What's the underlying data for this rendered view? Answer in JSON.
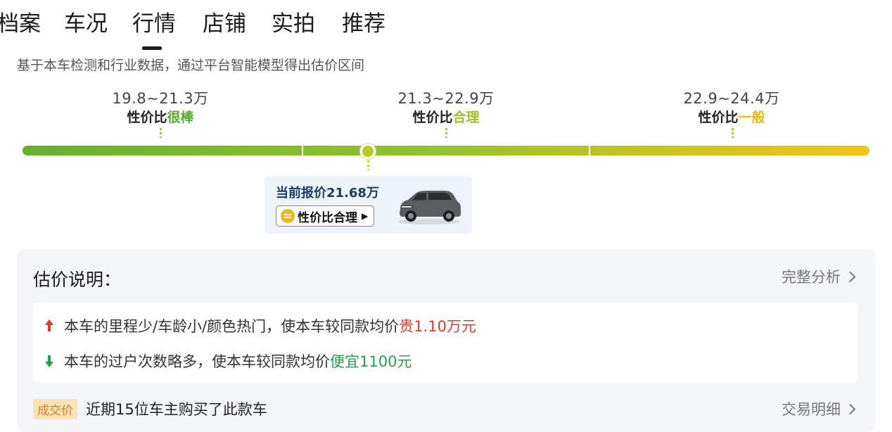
{
  "tabs": [
    {
      "label": "档案",
      "active": false
    },
    {
      "label": "车况",
      "active": false
    },
    {
      "label": "行情",
      "active": true
    },
    {
      "label": "店铺",
      "active": false
    },
    {
      "label": "实拍",
      "active": false
    },
    {
      "label": "推荐",
      "active": false
    }
  ],
  "subtitle": "基于本车检测和行业数据，通过平台智能模型得出估价区间",
  "segments": [
    {
      "range": "19.8~21.3万",
      "label_prefix": "性价比",
      "label_highlight": "很棒",
      "highlight_color": "#53ad2a"
    },
    {
      "range": "21.3~22.9万",
      "label_prefix": "性价比",
      "label_highlight": "合理",
      "highlight_color": "#9cc22b"
    },
    {
      "range": "22.9~24.4万",
      "label_prefix": "性价比",
      "label_highlight": "一般",
      "highlight_color": "#e8b816"
    }
  ],
  "current_price": {
    "text": "当前报价21.68万",
    "rating_label": "性价比合理",
    "car_icon": "suv-car-image"
  },
  "explanation": {
    "title": "估价说明：",
    "full_analysis_link": "完整分析",
    "reasons": [
      {
        "direction": "up",
        "prefix": "本车的里程少/车龄小/颜色热门，使本车较同款均价",
        "highlight": "贵1.10万元"
      },
      {
        "direction": "down",
        "prefix": "本车的过户次数略多，使本车较同款均价",
        "highlight": "便宜1100元"
      }
    ]
  },
  "deal": {
    "badge": "成交价",
    "text": "近期15位车主购买了此款车",
    "link": "交易明细"
  },
  "colors": {
    "bar_start": "#63b22e",
    "bar_end": "#f2c416",
    "price_up": "#e03a2a",
    "price_down": "#22a24a"
  }
}
